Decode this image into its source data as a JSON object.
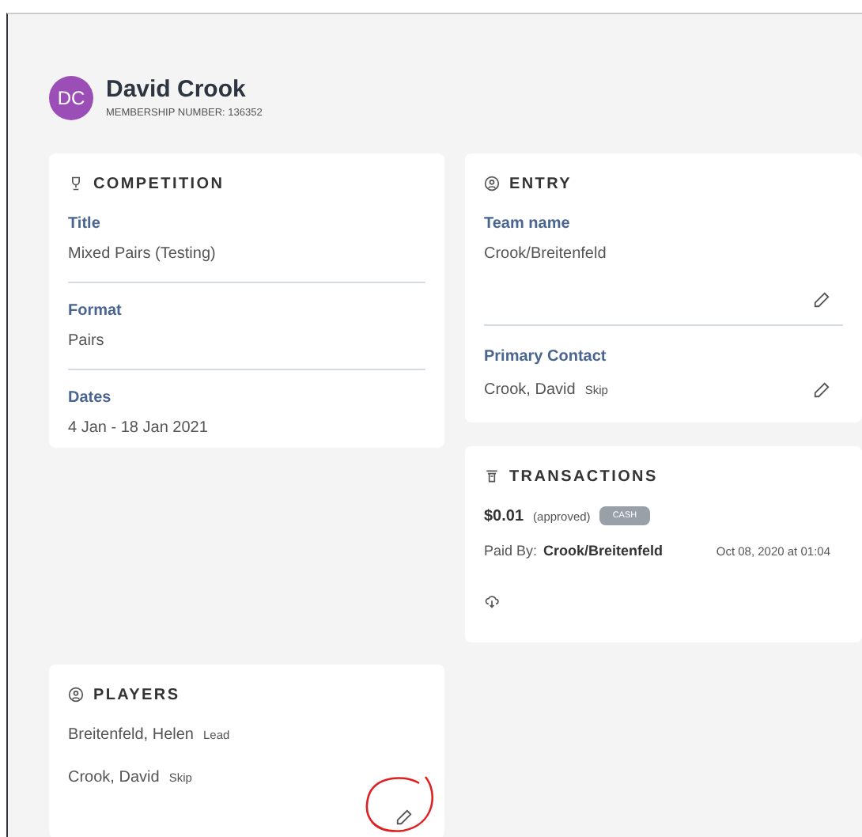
{
  "member": {
    "initials": "DC",
    "name": "David Crook",
    "membership": "MEMBERSHIP NUMBER: 136352"
  },
  "competition": {
    "heading": "COMPETITION",
    "fields": [
      {
        "label": "Title",
        "value": "Mixed Pairs (Testing)"
      },
      {
        "label": "Format",
        "value": "Pairs"
      },
      {
        "label": "Dates",
        "value": "4 Jan - 18 Jan 2021"
      }
    ]
  },
  "entry": {
    "heading": "ENTRY",
    "team_label": "Team name",
    "team": "Crook/Breitenfeld",
    "contact_label": "Primary Contact",
    "contact": "Crook, David",
    "contact_role": "Skip"
  },
  "transactions": {
    "heading": "TRANSACTIONS",
    "amount": "$0.01",
    "status": "(approved)",
    "method": "CASH",
    "paid_by_label": "Paid By:",
    "paid_by": "Crook/Breitenfeld",
    "date": "Oct 08, 2020 at 01:04"
  },
  "players": {
    "heading": "PLAYERS",
    "items": [
      {
        "name": "Breitenfeld, Helen",
        "role": "Lead"
      },
      {
        "name": "Crook, David",
        "role": "Skip"
      }
    ],
    "annotated": true
  }
}
